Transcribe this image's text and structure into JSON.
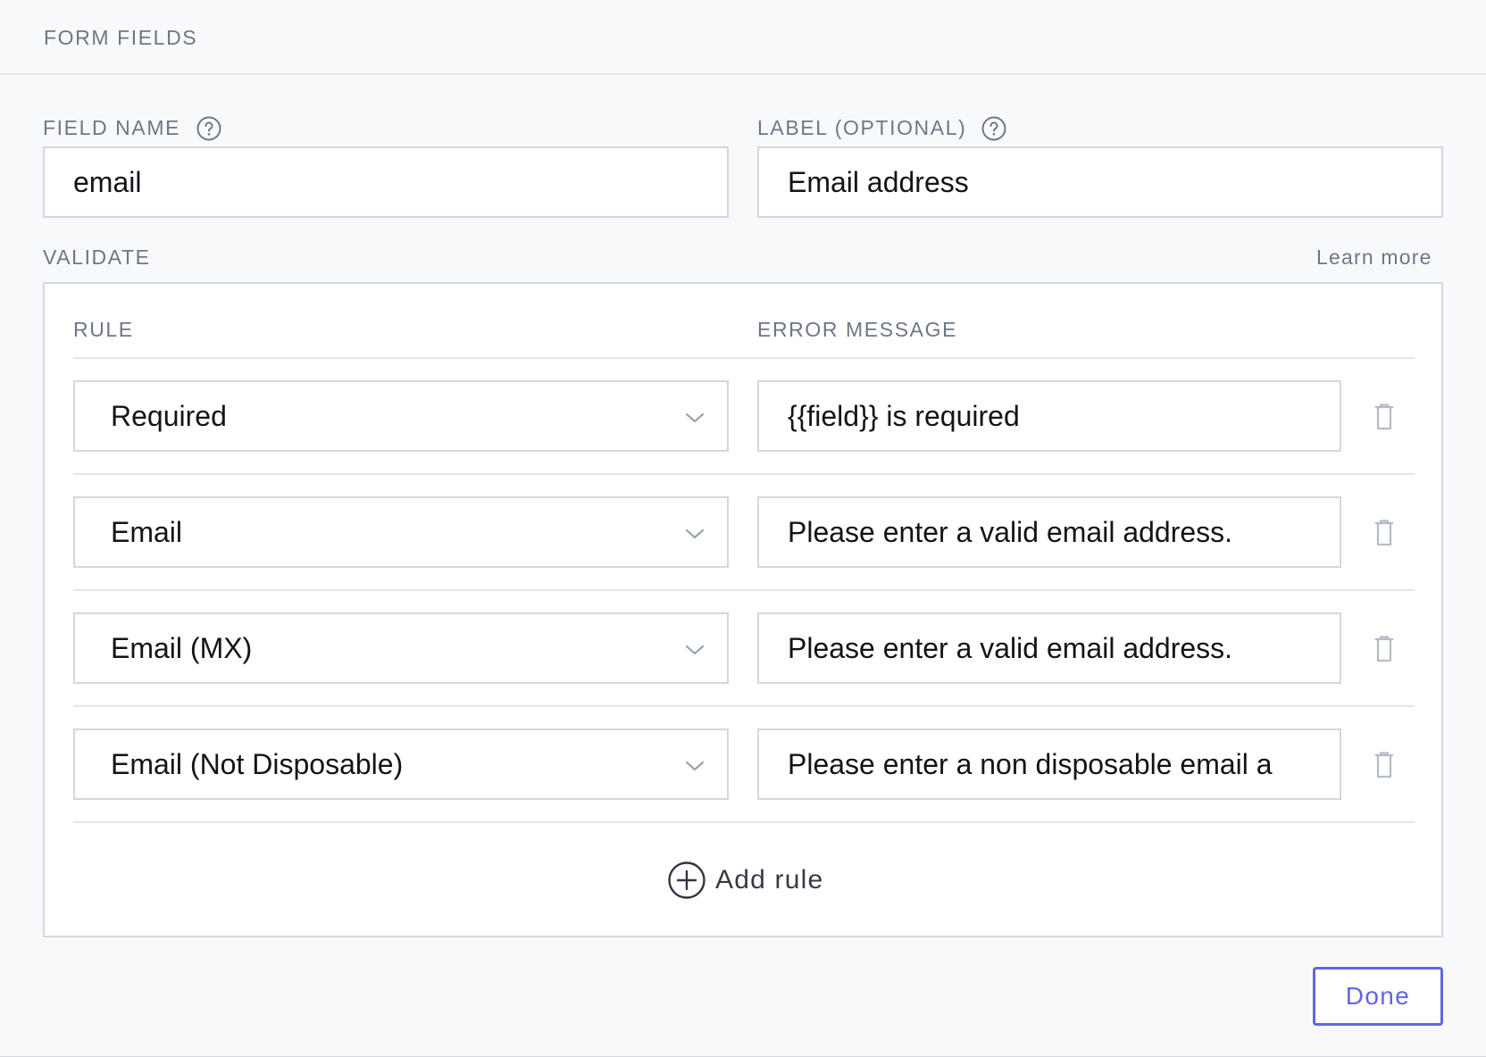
{
  "header": {
    "title": "FORM FIELDS"
  },
  "field_name": {
    "label": "FIELD NAME",
    "value": "email",
    "help_icon": "question-circle-icon"
  },
  "label_field": {
    "label": "LABEL (OPTIONAL)",
    "value": "Email address",
    "help_icon": "question-circle-icon"
  },
  "validate": {
    "title": "VALIDATE",
    "learn_more": "Learn more",
    "col_rule": "RULE",
    "col_error": "ERROR MESSAGE",
    "rules": [
      {
        "rule": "Required",
        "message": "{{field}} is required"
      },
      {
        "rule": "Email",
        "message": "Please enter a valid email address."
      },
      {
        "rule": "Email (MX)",
        "message": "Please enter a valid email address."
      },
      {
        "rule": "Email (Not Disposable)",
        "message": "Please enter a non disposable email a"
      }
    ],
    "add_rule": "Add rule"
  },
  "footer": {
    "done": "Done"
  },
  "colors": {
    "accent": "#6166e6",
    "muted": "#6f7785",
    "border": "#d3d7de"
  }
}
